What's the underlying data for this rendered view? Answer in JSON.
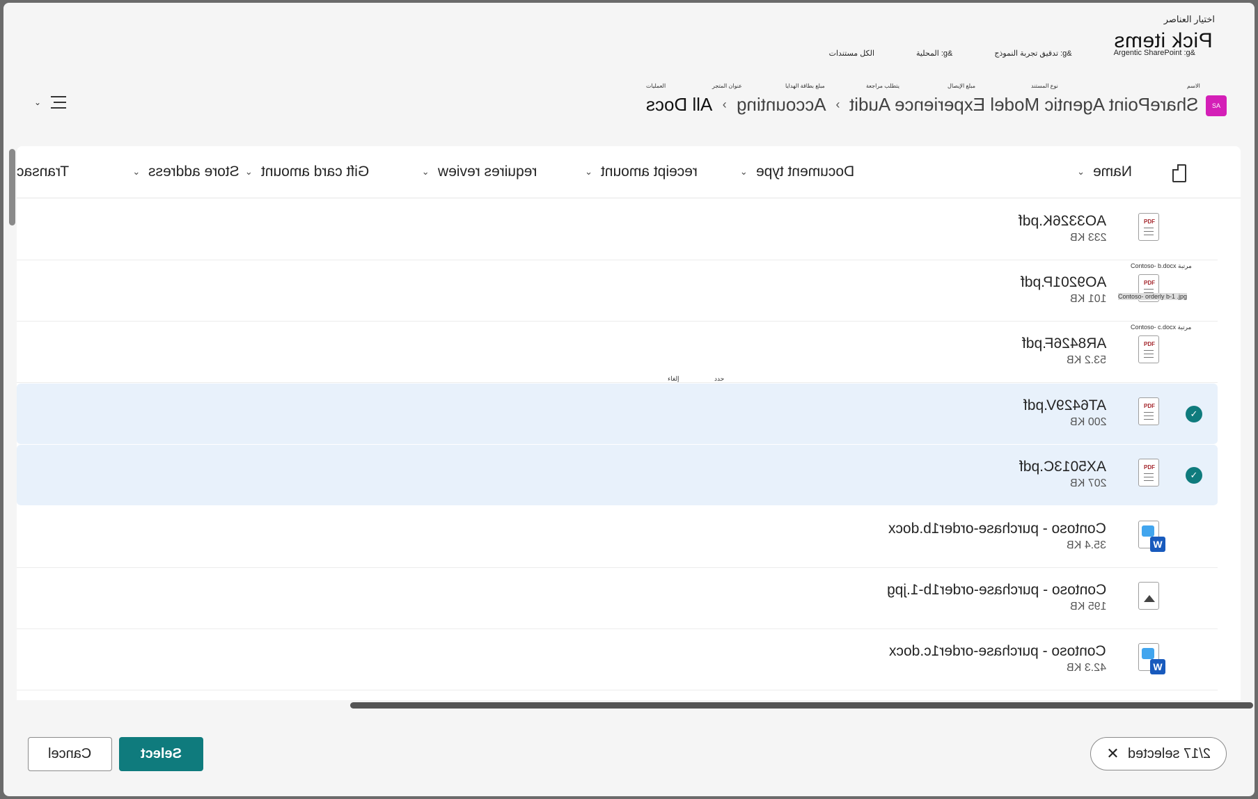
{
  "header": {
    "arabic_title": "اختيار العناصر",
    "title": "Pick items",
    "crumbs": [
      "Argentic SharePoint :g&",
      "تدقيق تجربة النموذج :g&",
      "المحلية :g&",
      "الكل مستندات"
    ],
    "arabic_col_headers": [
      "الاسم",
      "نوع المستند",
      "مبلغ الإيصال",
      "يتطلب مراجعة",
      "مبلغ بطاقة الهدايا",
      "عنوان المتجر",
      "العمليات"
    ]
  },
  "breadcrumb": {
    "site_badge": "SA",
    "items": [
      "SharePoint Agentic Model Experience Audit",
      "Accounting",
      "All Docs"
    ]
  },
  "columns": [
    "Name",
    "Document type",
    "receipt amount",
    "requires review",
    "Gift card amount",
    "Store address",
    "Transac"
  ],
  "rows": [
    {
      "name": "AO3326K.pdf",
      "size": "233 KB",
      "type": "pdf",
      "selected": false
    },
    {
      "name": "AO9201P.pdf",
      "size": "101 KB",
      "type": "pdf",
      "selected": false
    },
    {
      "name": "AR8426F.pdf",
      "size": "53.2 KB",
      "type": "pdf",
      "selected": false
    },
    {
      "name": "AT6429V.pdf",
      "size": "200 KB",
      "type": "pdf",
      "selected": true
    },
    {
      "name": "AX5013C.pdf",
      "size": "207 KB",
      "type": "pdf",
      "selected": true
    },
    {
      "name": "Contoso - purchase-order1b.docx",
      "size": "35.4 KB",
      "type": "word",
      "selected": false
    },
    {
      "name": "Contoso - purchase-order1b-1.jpg",
      "size": "195 KB",
      "type": "image",
      "selected": false
    },
    {
      "name": "Contoso - purchase-order1c.docx",
      "size": "42.3 KB",
      "type": "word",
      "selected": false
    }
  ],
  "overlay_texts": [
    "Contoso- b.docx مرتبة",
    "Contoso- orderly b-1 .jpg",
    "Contoso- c.docx مرتبة",
    "إلغاء",
    "حدد"
  ],
  "footer": {
    "selected_label": "2/17 selected",
    "select_label": "Select",
    "cancel_label": "Cancel"
  },
  "colors": {
    "accent": "#0f7b7d",
    "site_badge": "#d41fb7",
    "selected_row": "#e8f1fb"
  }
}
